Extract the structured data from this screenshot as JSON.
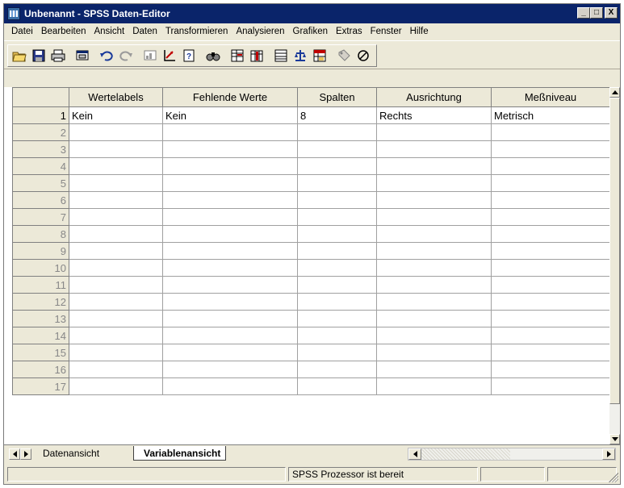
{
  "window": {
    "title": "Unbenannt - SPSS Daten-Editor"
  },
  "title_buttons": {
    "minimize": "_",
    "maximize": "□",
    "close": "X"
  },
  "menu": [
    "Datei",
    "Bearbeiten",
    "Ansicht",
    "Daten",
    "Transformieren",
    "Analysieren",
    "Grafiken",
    "Extras",
    "Fenster",
    "Hilfe"
  ],
  "toolbar": {
    "icons": [
      "open-folder-icon",
      "save-icon",
      "print-icon",
      "dialog-recall-icon",
      "undo-icon",
      "redo-icon",
      "goto-chart-icon",
      "goto-case-icon",
      "variables-icon",
      "find-icon",
      "insert-cases-icon",
      "insert-variable-icon",
      "split-file-icon",
      "weight-cases-icon",
      "select-cases-icon",
      "value-labels-icon",
      "use-sets-icon"
    ]
  },
  "grid": {
    "columns": [
      "Wertelabels",
      "Fehlende Werte",
      "Spalten",
      "Ausrichtung",
      "Meßniveau"
    ],
    "rows": [
      {
        "num": "1",
        "cells": [
          "Kein",
          "Kein",
          "8",
          "Rechts",
          "Metrisch"
        ]
      },
      {
        "num": "2",
        "cells": [
          "",
          "",
          "",
          "",
          ""
        ]
      },
      {
        "num": "3",
        "cells": [
          "",
          "",
          "",
          "",
          ""
        ]
      },
      {
        "num": "4",
        "cells": [
          "",
          "",
          "",
          "",
          ""
        ]
      },
      {
        "num": "5",
        "cells": [
          "",
          "",
          "",
          "",
          ""
        ]
      },
      {
        "num": "6",
        "cells": [
          "",
          "",
          "",
          "",
          ""
        ]
      },
      {
        "num": "7",
        "cells": [
          "",
          "",
          "",
          "",
          ""
        ]
      },
      {
        "num": "8",
        "cells": [
          "",
          "",
          "",
          "",
          ""
        ]
      },
      {
        "num": "9",
        "cells": [
          "",
          "",
          "",
          "",
          ""
        ]
      },
      {
        "num": "10",
        "cells": [
          "",
          "",
          "",
          "",
          ""
        ]
      },
      {
        "num": "11",
        "cells": [
          "",
          "",
          "",
          "",
          ""
        ]
      },
      {
        "num": "12",
        "cells": [
          "",
          "",
          "",
          "",
          ""
        ]
      },
      {
        "num": "13",
        "cells": [
          "",
          "",
          "",
          "",
          ""
        ]
      },
      {
        "num": "14",
        "cells": [
          "",
          "",
          "",
          "",
          ""
        ]
      },
      {
        "num": "15",
        "cells": [
          "",
          "",
          "",
          "",
          ""
        ]
      },
      {
        "num": "16",
        "cells": [
          "",
          "",
          "",
          "",
          ""
        ]
      },
      {
        "num": "17",
        "cells": [
          "",
          "",
          "",
          "",
          ""
        ]
      }
    ]
  },
  "tabs": {
    "data_view": "Datenansicht",
    "variable_view": "Variablenansicht"
  },
  "status": {
    "processor": "SPSS Prozessor  ist bereit"
  },
  "colors": {
    "titlebar": "#0a246a",
    "chrome": "#ece9d8",
    "grid_line": "#a0a0a0"
  }
}
